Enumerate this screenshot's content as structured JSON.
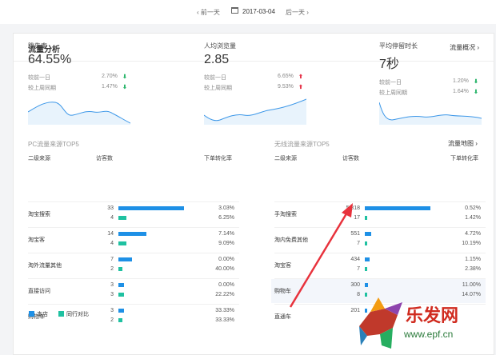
{
  "datebar": {
    "prev": "‹ 前一天",
    "date": "2017-03-04",
    "next": "后一天 ›"
  },
  "panel": {
    "title": "流量分析",
    "link": "流量概况 ›"
  },
  "kpis": [
    {
      "name": "跳失率",
      "value": "64.55%",
      "cmp1_label": "较前一日",
      "cmp1_pct": "2.70%",
      "cmp1_arrow": "⬇",
      "cmp2_label": "较上周同期",
      "cmp2_pct": "1.47%",
      "cmp2_arrow": "⬇"
    },
    {
      "name": "人均浏览量",
      "value": "2.85",
      "cmp1_label": "较前一日",
      "cmp1_pct": "6.65%",
      "cmp1_arrow": "⬆",
      "cmp2_label": "较上周同期",
      "cmp2_pct": "9.53%",
      "cmp2_arrow": "⬆"
    },
    {
      "name": "平均停留时长",
      "value": "7秒",
      "cmp1_label": "较前一日",
      "cmp1_pct": "1.20%",
      "cmp1_arrow": "⬇",
      "cmp2_label": "较上周同期",
      "cmp2_pct": "1.64%",
      "cmp2_arrow": "⬇"
    }
  ],
  "pc": {
    "title": "PC流量来源TOP5",
    "headers": {
      "source": "二级来源",
      "visitors": "访客数",
      "conversion": "下单转化率"
    },
    "rows": [
      {
        "source": "淘宝搜索",
        "v1": "33",
        "v2": "4",
        "c1": "3.03%",
        "c2": "6.25%",
        "b1": 33,
        "b2": 4
      },
      {
        "source": "淘宝客",
        "v1": "14",
        "v2": "4",
        "c1": "7.14%",
        "c2": "9.09%",
        "b1": 14,
        "b2": 4
      },
      {
        "source": "淘外流量其他",
        "v1": "7",
        "v2": "2",
        "c1": "0.00%",
        "c2": "40.00%",
        "b1": 7,
        "b2": 2
      },
      {
        "source": "直接访问",
        "v1": "3",
        "v2": "3",
        "c1": "0.00%",
        "c2": "22.22%",
        "b1": 3,
        "b2": 3
      },
      {
        "source": "购物车",
        "v1": "3",
        "v2": "2",
        "c1": "33.33%",
        "c2": "33.33%",
        "b1": 3,
        "b2": 2
      }
    ]
  },
  "wireless": {
    "title": "无线流量来源TOP5",
    "link": "流量地图 ›",
    "headers": {
      "source": "二级来源",
      "visitors": "访客数",
      "conversion": "下单转化率"
    },
    "rows": [
      {
        "source": "手淘搜索",
        "v1": "5,818",
        "v2": "17",
        "c1": "0.52%",
        "c2": "1.42%",
        "b1": 5818,
        "b2": 17
      },
      {
        "source": "淘内免费其他",
        "v1": "551",
        "v2": "7",
        "c1": "4.72%",
        "c2": "10.19%",
        "b1": 551,
        "b2": 7
      },
      {
        "source": "淘宝客",
        "v1": "434",
        "v2": "7",
        "c1": "1.15%",
        "c2": "2.38%",
        "b1": 434,
        "b2": 7
      },
      {
        "source": "购物车",
        "v1": "300",
        "v2": "8",
        "c1": "11.00%",
        "c2": "14.07%",
        "b1": 300,
        "b2": 8
      },
      {
        "source": "直通车",
        "v1": "201",
        "v2": "",
        "c1": "",
        "c2": "",
        "b1": 201,
        "b2": 0
      }
    ]
  },
  "legend": {
    "self": "本店",
    "peer": "同行对比"
  },
  "watermark": {
    "text": "乐发网",
    "sub": "www.epf.cn"
  },
  "colors": {
    "blue": "#1e90e6",
    "green": "#1fc1a1",
    "up": "#e6344a",
    "down": "#2ab56b",
    "arrow": "#e8323c"
  }
}
